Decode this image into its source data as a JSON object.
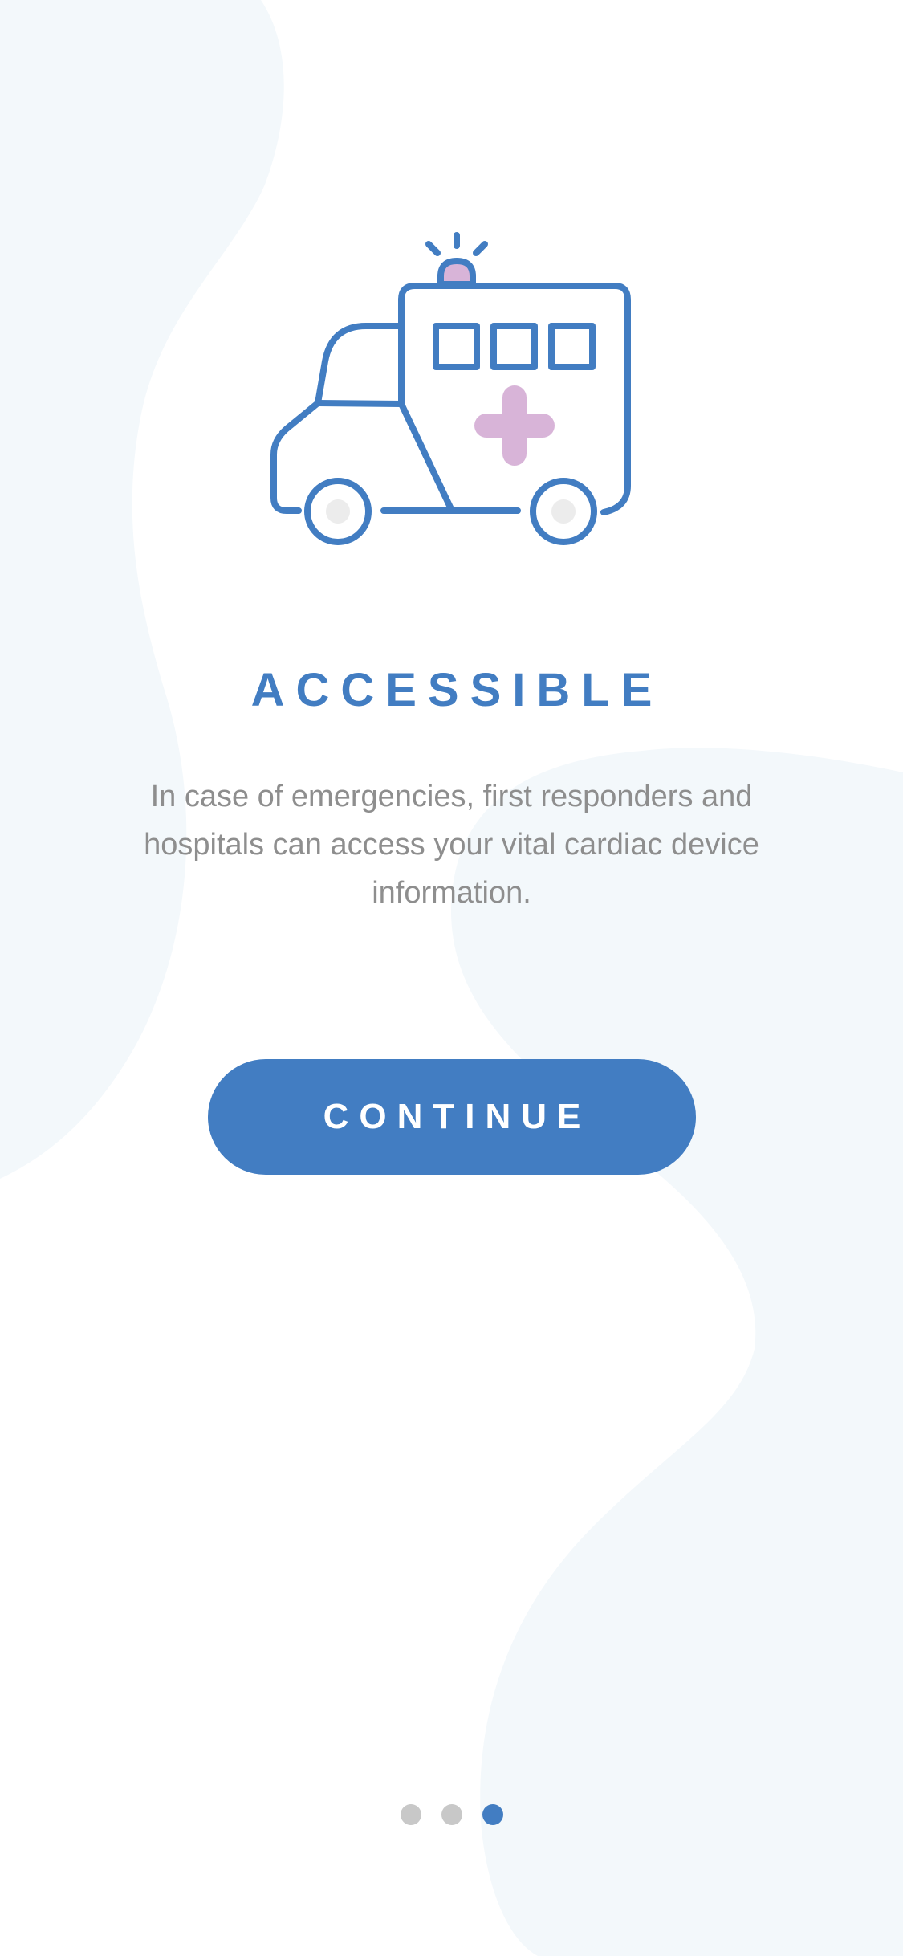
{
  "onboarding": {
    "title": "ACCESSIBLE",
    "description": "In case of emergencies, first responders and hospitals can access your vital cardiac device information.",
    "continue_label": "CONTINUE",
    "illustration_icon": "ambulance-icon",
    "page_indicator": {
      "total_pages": 3,
      "current_page": 3
    }
  },
  "colors": {
    "accent": "#427dc2",
    "text_muted": "#8e8e8e",
    "cross": "#d8b4d8",
    "background_wave": "#f3f8fb",
    "dot_inactive": "#c8c8c8"
  }
}
